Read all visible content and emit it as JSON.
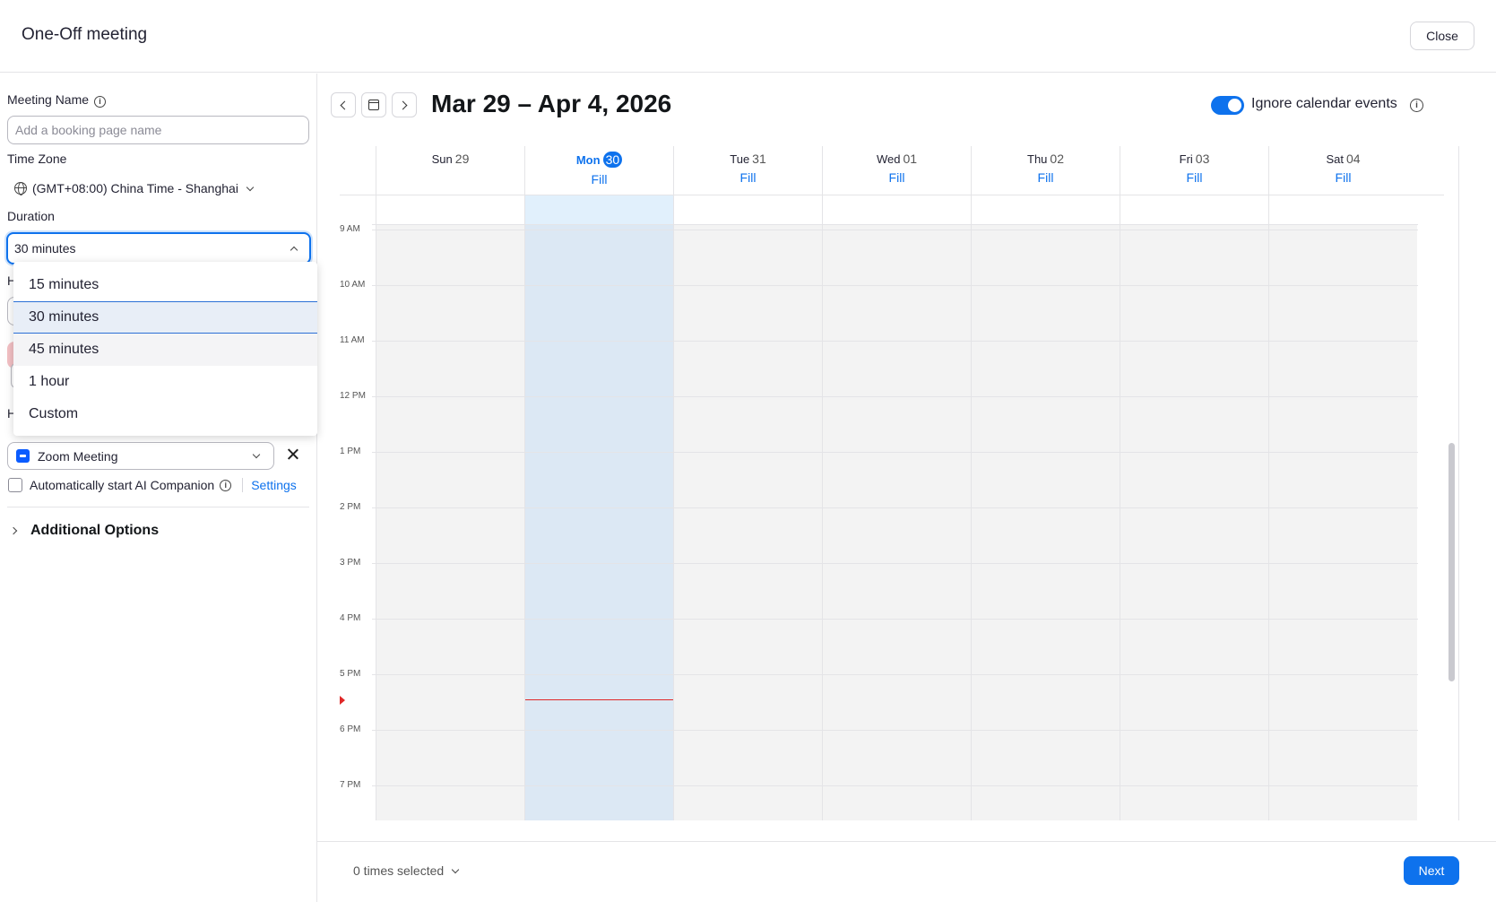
{
  "header": {
    "title": "One-Off meeting",
    "close_label": "Close"
  },
  "form": {
    "meeting_name": {
      "label": "Meeting Name",
      "placeholder": "Add a booking page name",
      "value": ""
    },
    "time_zone": {
      "label": "Time Zone",
      "value": "(GMT+08:00) China Time - Shanghai"
    },
    "duration": {
      "label": "Duration",
      "value": "30 minutes",
      "options": [
        "15 minutes",
        "30 minutes",
        "45 minutes",
        "1 hour",
        "Custom"
      ],
      "selected_index": 1,
      "hover_index": 2
    },
    "hidden_label_1": "H",
    "hidden_label_2": "H",
    "location": {
      "value": "Zoom Meeting"
    },
    "ai_companion": {
      "label": "Automatically start AI Companion",
      "checked": false,
      "settings_label": "Settings"
    },
    "additional_options": "Additional Options"
  },
  "calendar": {
    "date_range": "Mar 29 – Apr 4, 2026",
    "ignore_events_label": "Ignore calendar events",
    "ignore_events_on": true,
    "fill_label": "Fill",
    "days": [
      {
        "dow": "Sun",
        "date": "29",
        "fill": false,
        "today": false
      },
      {
        "dow": "Mon",
        "date": "30",
        "fill": true,
        "today": true
      },
      {
        "dow": "Tue",
        "date": "31",
        "fill": true,
        "today": false
      },
      {
        "dow": "Wed",
        "date": "01",
        "fill": true,
        "today": false
      },
      {
        "dow": "Thu",
        "date": "02",
        "fill": true,
        "today": false
      },
      {
        "dow": "Fri",
        "date": "03",
        "fill": true,
        "today": false
      },
      {
        "dow": "Sat",
        "date": "04",
        "fill": true,
        "today": false
      }
    ],
    "hours": [
      "9 AM",
      "10 AM",
      "11 AM",
      "12 PM",
      "1 PM",
      "2 PM",
      "3 PM",
      "4 PM",
      "5 PM",
      "6 PM",
      "7 PM"
    ],
    "current_time_fraction": 0.45
  },
  "footer": {
    "times_selected": "0 times selected",
    "next_label": "Next"
  },
  "colors": {
    "accent": "#0e72ed",
    "now_line": "#e02828"
  }
}
